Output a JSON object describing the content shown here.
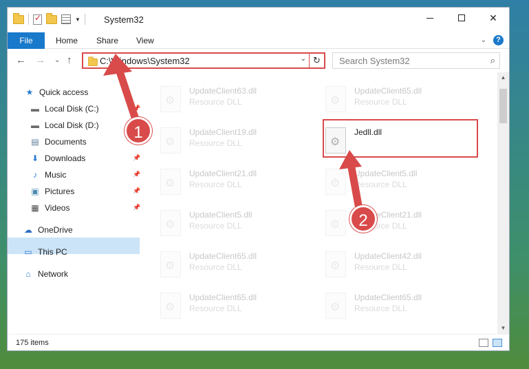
{
  "window": {
    "title": "System32",
    "caption_min": "",
    "caption_close": "✕"
  },
  "ribbon": {
    "tabs": [
      "File",
      "Home",
      "Share",
      "View"
    ],
    "expand_glyph": "⌄",
    "help_glyph": "?"
  },
  "address": {
    "path": "C:\\Windows\\System32",
    "dropdown_glyph": "⌄",
    "refresh_glyph": "↻"
  },
  "search": {
    "placeholder": "Search System32",
    "glyph": "⌕"
  },
  "nav": {
    "back": "←",
    "forward": "→",
    "recent": "⌄",
    "up": "↑",
    "items": [
      {
        "label": "Quick access",
        "icon": "star-icon",
        "glyph": "★",
        "color": "#2b7bd3",
        "pinned": false
      },
      {
        "label": "Local Disk (C:)",
        "icon": "drive-icon",
        "glyph": "▬",
        "color": "#6a6a6a",
        "pinned": true
      },
      {
        "label": "Local Disk (D:)",
        "icon": "drive-icon",
        "glyph": "▬",
        "color": "#6a6a6a",
        "pinned": false
      },
      {
        "label": "Documents",
        "icon": "documents-icon",
        "glyph": "▤",
        "color": "#5a7a9a",
        "pinned": true
      },
      {
        "label": "Downloads",
        "icon": "download-icon",
        "glyph": "⬇",
        "color": "#2b7bd3",
        "pinned": true
      },
      {
        "label": "Music",
        "icon": "music-icon",
        "glyph": "♪",
        "color": "#2b7bd3",
        "pinned": true
      },
      {
        "label": "Pictures",
        "icon": "pictures-icon",
        "glyph": "▣",
        "color": "#4a8ab0",
        "pinned": true
      },
      {
        "label": "Videos",
        "icon": "videos-icon",
        "glyph": "▦",
        "color": "#4a4a4a",
        "pinned": true
      },
      {
        "label": "OneDrive",
        "icon": "cloud-icon",
        "glyph": "☁",
        "color": "#2b6fc0",
        "pinned": false
      },
      {
        "label": "This PC",
        "icon": "computer-icon",
        "glyph": "▭",
        "color": "#2b7bd3",
        "pinned": false
      },
      {
        "label": "Network",
        "icon": "network-icon",
        "glyph": "⌂",
        "color": "#2b7bd3",
        "pinned": false
      }
    ]
  },
  "files": {
    "left_column": [
      {
        "name": "UpdateClient63.dll",
        "type": "Resource DLL"
      },
      {
        "name": "UpdateClient19.dll",
        "type": "Resource DLL"
      },
      {
        "name": "UpdateClient21.dll",
        "type": "Resource DLL"
      },
      {
        "name": "UpdateClient5.dll",
        "type": "Resource DLL"
      },
      {
        "name": "UpdateClient65.dll",
        "type": "Resource DLL"
      },
      {
        "name": "UpdateClient65.dll",
        "type": "Resource DLL"
      }
    ],
    "right_column": [
      {
        "name": "UpdateClient65.dll",
        "type": "Resource DLL"
      },
      {
        "name": "Jedll.dll",
        "type": ""
      },
      {
        "name": "UpdateClient5.dll",
        "type": "Resource DLL"
      },
      {
        "name": "UpdateClient21.dll",
        "type": "Resource DLL"
      },
      {
        "name": "UpdateClient42.dll",
        "type": "Resource DLL"
      },
      {
        "name": "UpdateClient65.dll",
        "type": "Resource DLL"
      }
    ]
  },
  "status": {
    "item_count": "175 items"
  },
  "callouts": {
    "step1": "1",
    "step2": "2",
    "color": "#d94a4a"
  }
}
